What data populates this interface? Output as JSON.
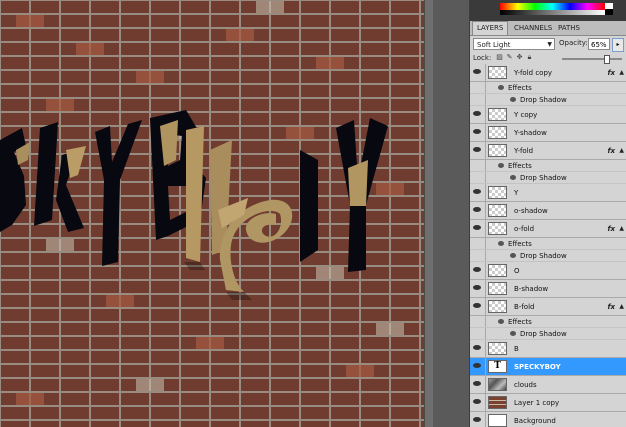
{
  "canvas": {
    "image_text": "SPECKYBOY"
  },
  "panel": {
    "tabs": [
      {
        "label": "LAYERS",
        "active": true
      },
      {
        "label": "CHANNELS",
        "active": false
      },
      {
        "label": "PATHS",
        "active": false
      }
    ],
    "blend_mode": "Soft Light",
    "opacity_label": "Opacity:",
    "opacity_value": "65%",
    "lock_label": "Lock:",
    "layers": [
      {
        "name": "Y-fold copy",
        "fx": true,
        "thumb": "transparent"
      },
      {
        "sub": "Effects"
      },
      {
        "sub": "Drop Shadow",
        "indent": true
      },
      {
        "name": "Y copy",
        "thumb": "transparent"
      },
      {
        "name": "Y-shadow",
        "thumb": "transparent"
      },
      {
        "name": "Y-fold",
        "fx": true,
        "thumb": "transparent"
      },
      {
        "sub": "Effects"
      },
      {
        "sub": "Drop Shadow",
        "indent": true
      },
      {
        "name": "Y",
        "thumb": "transparent"
      },
      {
        "name": "o-shadow",
        "thumb": "transparent"
      },
      {
        "name": "o-fold",
        "fx": true,
        "thumb": "transparent"
      },
      {
        "sub": "Effects"
      },
      {
        "sub": "Drop Shadow",
        "indent": true
      },
      {
        "name": "O",
        "thumb": "transparent"
      },
      {
        "name": "B-shadow",
        "thumb": "transparent"
      },
      {
        "name": "B-fold",
        "fx": true,
        "thumb": "transparent"
      },
      {
        "sub": "Effects"
      },
      {
        "sub": "Drop Shadow",
        "indent": true
      },
      {
        "name": "B",
        "thumb": "transparent"
      },
      {
        "name": "SPECKYBOY",
        "thumb": "text",
        "thumb_label": "T",
        "selected": true
      },
      {
        "name": "clouds",
        "thumb": "clouds"
      },
      {
        "name": "Layer 1 copy",
        "thumb": "brick"
      },
      {
        "name": "Background",
        "thumb": "white"
      }
    ],
    "fx_label": "fx",
    "colors": {
      "selection": "#3399ff",
      "panel_bg": "#d4d4d4"
    }
  }
}
